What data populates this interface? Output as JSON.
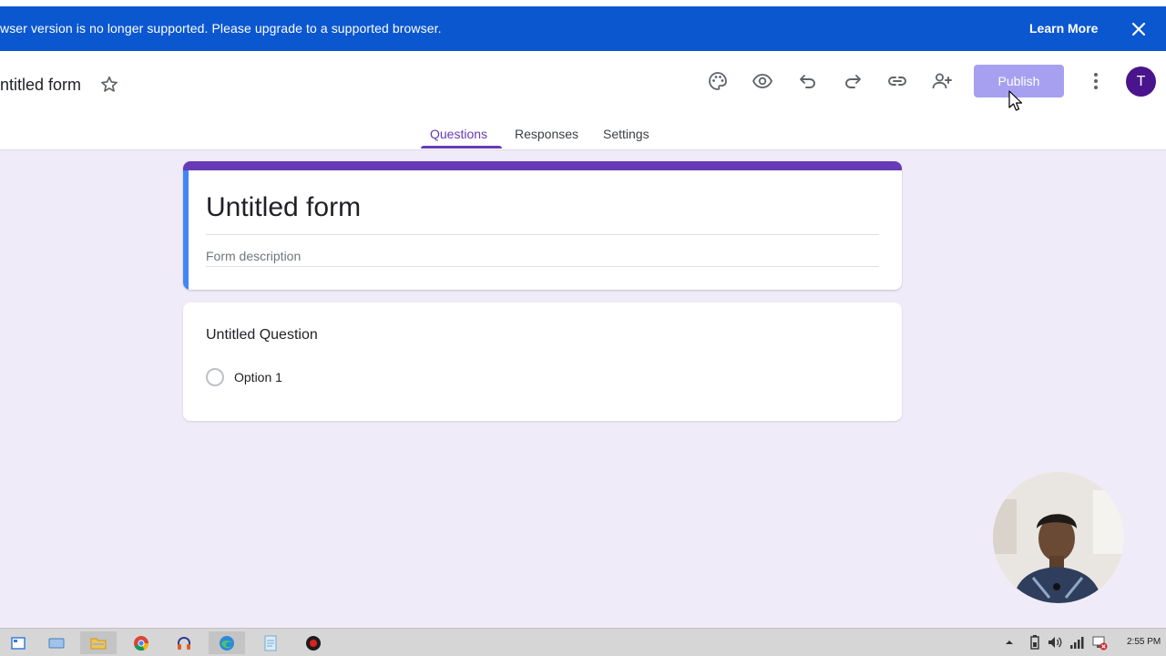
{
  "banner": {
    "message": "wser version is no longer supported. Please upgrade to a supported browser.",
    "learn_more": "Learn More",
    "close_icon": "close-icon"
  },
  "header": {
    "doc_title": "ntitled form",
    "publish_label": "Publish",
    "avatar_letter": "T",
    "icons": [
      "star-icon",
      "palette-icon",
      "eye-icon",
      "undo-icon",
      "redo-icon",
      "link-icon",
      "add-person-icon",
      "more-vert-icon"
    ]
  },
  "tabs": [
    {
      "label": "Questions",
      "active": true
    },
    {
      "label": "Responses",
      "active": false
    },
    {
      "label": "Settings",
      "active": false
    }
  ],
  "form": {
    "title": "Untitled form",
    "description_placeholder": "Form description"
  },
  "question": {
    "title": "Untitled Question",
    "options": [
      "Option 1"
    ]
  },
  "taskbar": {
    "clock": "2:55 PM",
    "apps": [
      "start-icon",
      "keyboard-icon",
      "file-explorer-icon",
      "chrome-icon",
      "headphones-icon",
      "browser-icon",
      "notepad-icon",
      "record-icon"
    ]
  },
  "colors": {
    "banner": "#0b57d0",
    "accent": "#673ab7",
    "publish": "#a7a0f0",
    "form_left_accent": "#4285f4",
    "background": "#f0ebf8",
    "avatar": "#4a148c"
  }
}
